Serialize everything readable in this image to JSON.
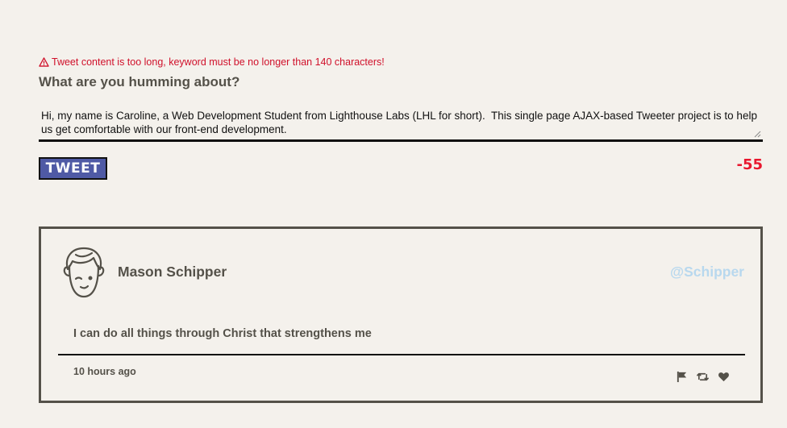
{
  "compose": {
    "error_icon": "warning-icon",
    "error_message": "Tweet content is too long, keyword must be no longer than 140 characters!",
    "prompt": "What are you humming about?",
    "text_value": "Hi, my name is Caroline, a Web Development Student from Lighthouse Labs (LHL for short).  This single page AJAX-based Tweeter project is to help us get comfortable with our front-end development.",
    "submit_label": "TWEET",
    "char_counter": "-55"
  },
  "tweets": [
    {
      "avatar_icon": "face-avatar-icon",
      "author_name": "Mason Schipper",
      "handle": "@Schipper",
      "content": "I can do all things through Christ that strengthens me",
      "timestamp": "10 hours ago",
      "actions": [
        "flag-icon",
        "retweet-icon",
        "heart-icon"
      ]
    }
  ],
  "colors": {
    "background": "#f4f1ec",
    "text": "#545149",
    "error": "#d0102a",
    "counter_negative": "#e8182f",
    "button": "#4f5aa5",
    "handle": "#b8d8ee"
  }
}
